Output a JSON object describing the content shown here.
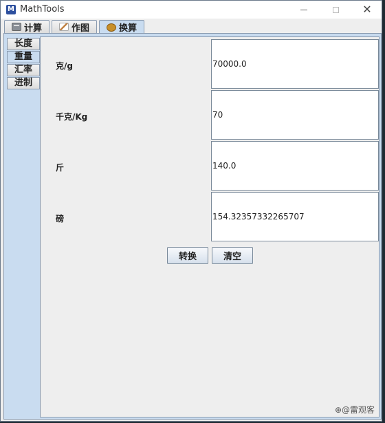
{
  "window": {
    "title": "MathTools",
    "app_icon_letter": "M",
    "close_glyph": "✕"
  },
  "top_tabs": [
    {
      "label": "计算",
      "icon": "calculator-icon",
      "active": false
    },
    {
      "label": "作图",
      "icon": "plot-icon",
      "active": false
    },
    {
      "label": "换算",
      "icon": "convert-icon",
      "active": true
    }
  ],
  "side_tabs": [
    {
      "label": "长度",
      "active": false
    },
    {
      "label": "重量",
      "active": true
    },
    {
      "label": "汇率",
      "active": false
    },
    {
      "label": "进制",
      "active": false
    }
  ],
  "rows": [
    {
      "label": "克/g",
      "value": "70000.0"
    },
    {
      "label": "千克/Kg",
      "value": "70"
    },
    {
      "label": "斤",
      "value": "140.0"
    },
    {
      "label": "磅",
      "value": "154.32357332265707"
    }
  ],
  "buttons": {
    "convert": "转换",
    "clear": "清空"
  },
  "watermark": "⊕@雷观客",
  "colors": {
    "accent": "#c9dcf0",
    "panel_bg": "#eeeeee"
  }
}
